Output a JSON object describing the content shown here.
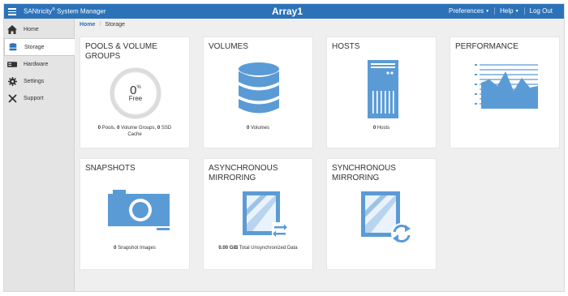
{
  "header": {
    "app_title": "SANtricity",
    "app_title_mark": "®",
    "app_title_rest": " System Manager",
    "array_name": "Array1",
    "nav": [
      {
        "label": "Preferences",
        "dropdown": true
      },
      {
        "label": "Help",
        "dropdown": true
      },
      {
        "label": "Log Out",
        "dropdown": false
      }
    ]
  },
  "sidebar": {
    "items": [
      {
        "label": "Home",
        "icon": "home-icon",
        "active": false
      },
      {
        "label": "Storage",
        "icon": "database-icon",
        "active": true
      },
      {
        "label": "Hardware",
        "icon": "hardware-icon",
        "active": false
      },
      {
        "label": "Settings",
        "icon": "gear-icon",
        "active": false
      },
      {
        "label": "Support",
        "icon": "tools-icon",
        "active": false
      }
    ]
  },
  "breadcrumb": {
    "home": "Home",
    "separator": "/",
    "current": "Storage"
  },
  "tiles": {
    "pools": {
      "title_line1": "POOLS & VOLUME",
      "title_line2": "GROUPS",
      "gauge_value": "0",
      "gauge_unit": "%",
      "gauge_label": "Free",
      "pools_count": "0",
      "pools_text": " Pools, ",
      "vg_count": "0",
      "vg_text": " Volume Groups, ",
      "ssd_count": "0",
      "ssd_text": " SSD",
      "cache_text": "Cache"
    },
    "volumes": {
      "title": "VOLUMES",
      "count": "0",
      "text": " Volumes"
    },
    "hosts": {
      "title": "HOSTS",
      "count": "0",
      "text": " Hosts"
    },
    "performance": {
      "title": "PERFORMANCE"
    },
    "snapshots": {
      "title": "SNAPSHOTS",
      "count": "0",
      "text": " Snapshot Images"
    },
    "async": {
      "title_line1": "ASYNCHRONOUS",
      "title_line2": "MIRRORING",
      "amount": "0.00 GiB",
      "text": " Total Unsynchronized Data"
    },
    "sync": {
      "title_line1": "SYNCHRONOUS",
      "title_line2": "MIRRORING"
    }
  },
  "colors": {
    "accent": "#2c72b9",
    "icon_blue": "#5b9bd5",
    "icon_dark": "#3f7fc0"
  }
}
